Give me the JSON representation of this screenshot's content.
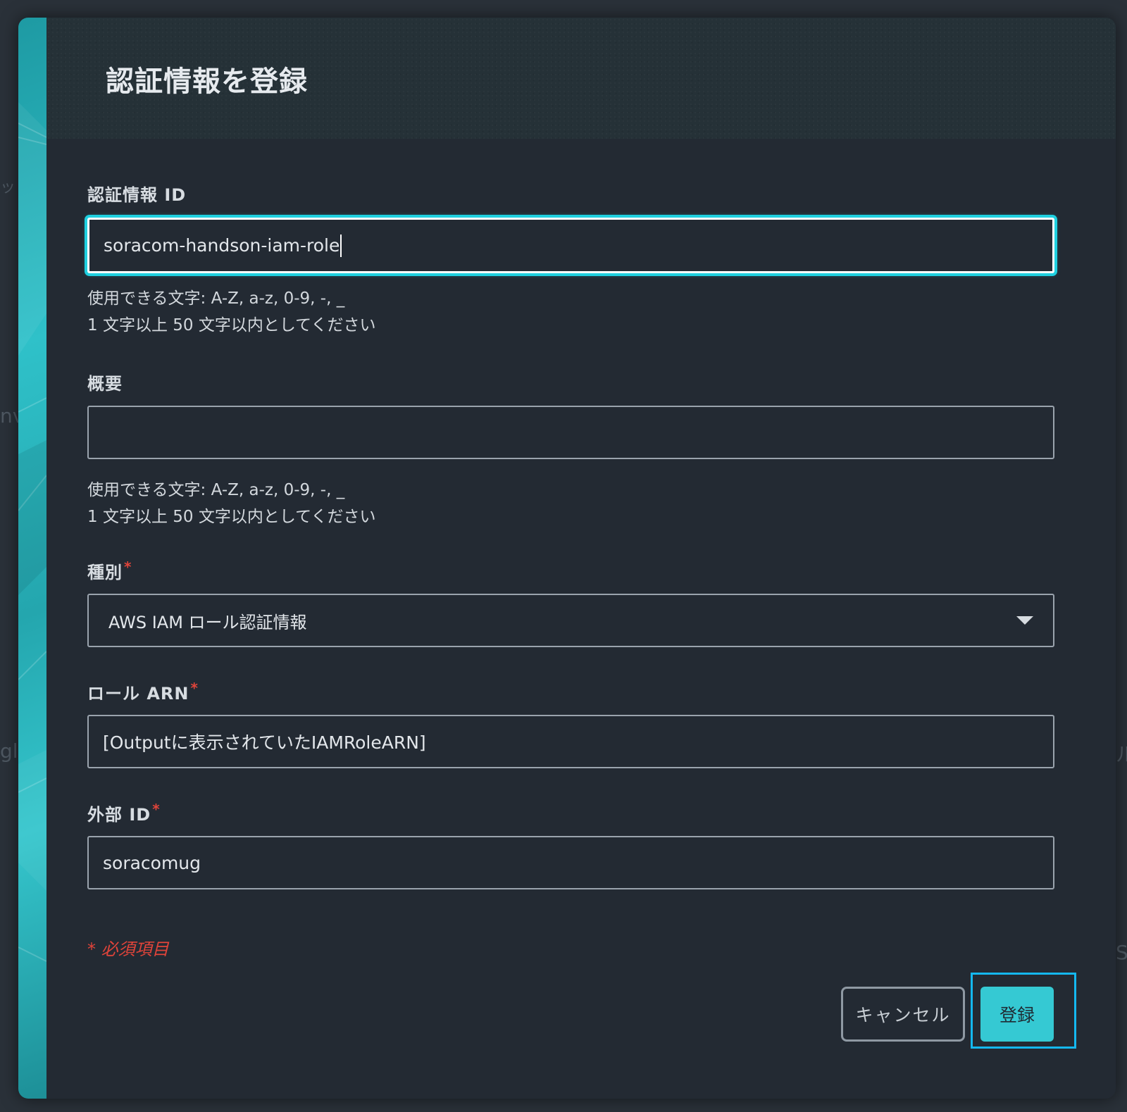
{
  "background": {
    "edge_texts": [
      "ッ",
      "nvc",
      "gle",
      "ル",
      "S"
    ]
  },
  "modal": {
    "title": "認証情報を登録",
    "fields": {
      "credential_id": {
        "label": "認証情報 ID",
        "value": "soracom-handson-iam-role",
        "helper_line1": "使用できる文字: A-Z, a-z, 0-9, -, _",
        "helper_line2": "1 文字以上 50 文字以内としてください"
      },
      "description": {
        "label": "概要",
        "value": "",
        "helper_line1": "使用できる文字: A-Z, a-z, 0-9, -, _",
        "helper_line2": "1 文字以上 50 文字以内としてください"
      },
      "type": {
        "label": "種別",
        "required_mark": "*",
        "selected": "AWS IAM ロール認証情報"
      },
      "role_arn": {
        "label": "ロール ARN",
        "required_mark": "*",
        "value": "[Outputに表示されていたIAMRoleARN]"
      },
      "external_id": {
        "label": "外部 ID",
        "required_mark": "*",
        "value": "soracomug"
      }
    },
    "required_note": "* 必須項目",
    "buttons": {
      "cancel_label": "キャンセル",
      "submit_label": "登録"
    }
  },
  "colors": {
    "accent": "#35c9d3",
    "focus_ring": "#1fd0e0",
    "required": "#e0443a",
    "highlight_box": "#14b8f0",
    "modal_bg": "#232a33"
  }
}
